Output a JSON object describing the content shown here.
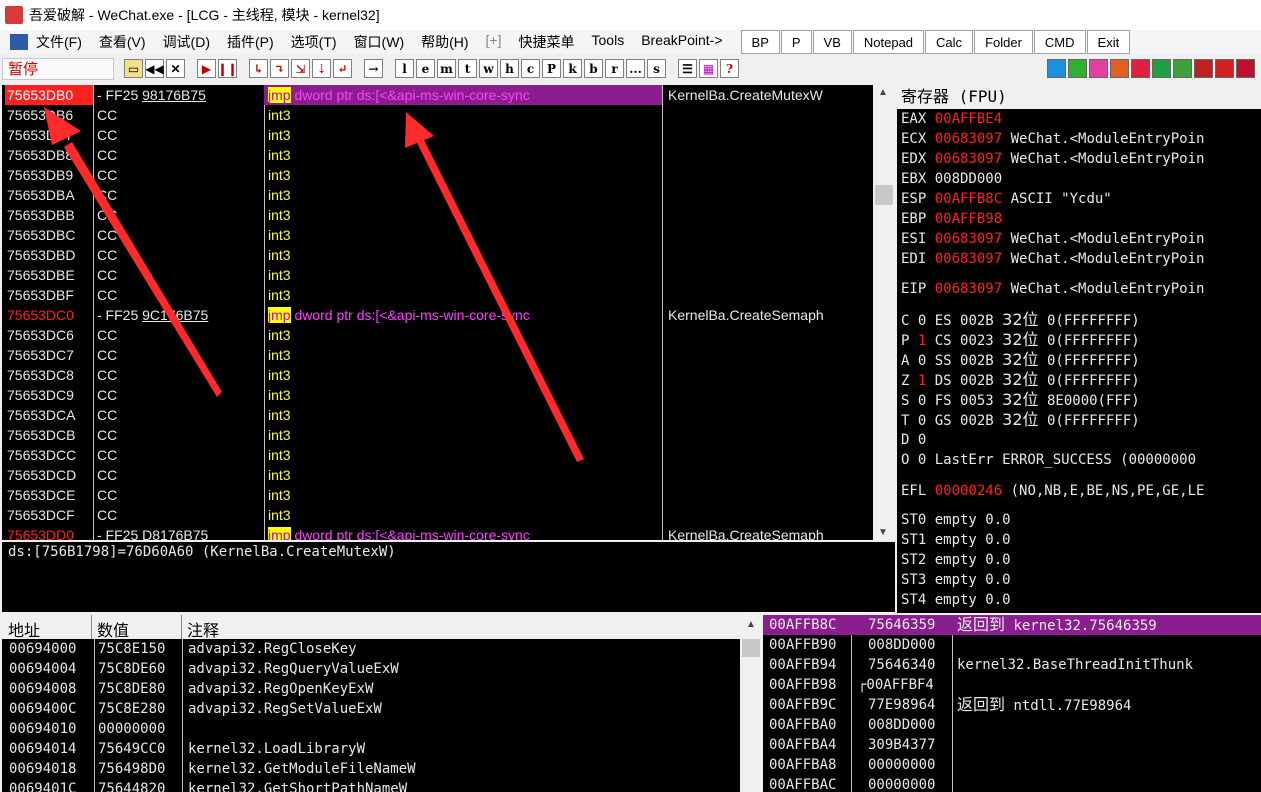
{
  "window": {
    "title": "吾爱破解 - WeChat.exe - [LCG -  主线程, 模块 - kernel32]"
  },
  "menu": {
    "items": [
      "文件(F)",
      "查看(V)",
      "调试(D)",
      "插件(P)",
      "选项(T)",
      "窗口(W)",
      "帮助(H)",
      "[+]",
      "快捷菜单",
      "Tools",
      "BreakPoint->"
    ],
    "buttons": [
      "BP",
      "P",
      "VB",
      "Notepad",
      "Calc",
      "Folder",
      "CMD",
      "Exit"
    ]
  },
  "toolbar": {
    "state": "暂停",
    "letters": [
      "l",
      "e",
      "m",
      "t",
      "w",
      "h",
      "c",
      "P",
      "k",
      "b",
      "r",
      "...",
      "s"
    ],
    "colors": {
      "plugin_boxes": [
        "#1e8fe0",
        "#2fb02f",
        "#e040a0",
        "#e06020",
        "#e02040",
        "#20a040",
        "#40a040",
        "#c02020",
        "#d02020",
        "#c01030"
      ]
    }
  },
  "disasm": {
    "rows": [
      {
        "addr": "75653DB0",
        "sep": "-",
        "hex": "FF25",
        "hexu": "98176B75",
        "asm_kw": "jmp",
        "asm": " dword ptr ds:[<&api-ms-win-core-sync",
        "cmt": "KernelBa.CreateMutexW",
        "highlight": true
      },
      {
        "addr": "75653DB6",
        "hex": "CC",
        "asm": "int3"
      },
      {
        "addr": "75653DB7",
        "hex": "CC",
        "asm": "int3"
      },
      {
        "addr": "75653DB8",
        "hex": "CC",
        "asm": "int3"
      },
      {
        "addr": "75653DB9",
        "hex": "CC",
        "asm": "int3"
      },
      {
        "addr": "75653DBA",
        "hex": "CC",
        "asm": "int3"
      },
      {
        "addr": "75653DBB",
        "hex": "CC",
        "asm": "int3"
      },
      {
        "addr": "75653DBC",
        "hex": "CC",
        "asm": "int3"
      },
      {
        "addr": "75653DBD",
        "hex": "CC",
        "asm": "int3"
      },
      {
        "addr": "75653DBE",
        "hex": "CC",
        "asm": "int3"
      },
      {
        "addr": "75653DBF",
        "hex": "CC",
        "asm": "int3"
      },
      {
        "addr": "75653DC0",
        "sep": "-",
        "hex": "FF25",
        "hexu": "9C176B75",
        "asm_kw": "jmp",
        "asm": " dword ptr ds:[<&api-ms-win-core-sync",
        "cmt": "KernelBa.CreateSemaph",
        "red": true
      },
      {
        "addr": "75653DC6",
        "hex": "CC",
        "asm": "int3"
      },
      {
        "addr": "75653DC7",
        "hex": "CC",
        "asm": "int3"
      },
      {
        "addr": "75653DC8",
        "hex": "CC",
        "asm": "int3"
      },
      {
        "addr": "75653DC9",
        "hex": "CC",
        "asm": "int3"
      },
      {
        "addr": "75653DCA",
        "hex": "CC",
        "asm": "int3"
      },
      {
        "addr": "75653DCB",
        "hex": "CC",
        "asm": "int3"
      },
      {
        "addr": "75653DCC",
        "hex": "CC",
        "asm": "int3"
      },
      {
        "addr": "75653DCD",
        "hex": "CC",
        "asm": "int3"
      },
      {
        "addr": "75653DCE",
        "hex": "CC",
        "asm": "int3"
      },
      {
        "addr": "75653DCF",
        "hex": "CC",
        "asm": "int3"
      },
      {
        "addr": "75653DD0",
        "sep": "-",
        "hex": "FF25",
        "hexu": "D8176B75",
        "asm_kw": "jmp",
        "asm": " dword ptr ds:[<&api-ms-win-core-sync",
        "cmt": "KernelBa.CreateSemaph",
        "red": true
      }
    ]
  },
  "info": {
    "line": "ds:[756B1798]=76D60A60 (KernelBa.CreateMutexW)"
  },
  "registers": {
    "title": "寄存器 (FPU)",
    "gp": [
      {
        "name": "EAX",
        "value": "00AFFBE4",
        "note": "",
        "changed": true
      },
      {
        "name": "ECX",
        "value": "00683097",
        "note": "WeChat.<ModuleEntryPoin",
        "changed": true
      },
      {
        "name": "EDX",
        "value": "00683097",
        "note": "WeChat.<ModuleEntryPoin",
        "changed": true
      },
      {
        "name": "EBX",
        "value": "008DD000",
        "note": "",
        "changed": false
      },
      {
        "name": "ESP",
        "value": "00AFFB8C",
        "note": "ASCII \"Ycdu\"",
        "changed": true
      },
      {
        "name": "EBP",
        "value": "00AFFB98",
        "note": "",
        "changed": true
      },
      {
        "name": "ESI",
        "value": "00683097",
        "note": "WeChat.<ModuleEntryPoin",
        "changed": true
      },
      {
        "name": "EDI",
        "value": "00683097",
        "note": "WeChat.<ModuleEntryPoin",
        "changed": true
      }
    ],
    "eip": {
      "name": "EIP",
      "value": "00683097",
      "note": "WeChat.<ModuleEntryPoin"
    },
    "segs": [
      {
        "flag": "C",
        "fv": "0",
        "seg": "ES",
        "sv": "002B",
        "bits": "32位",
        "base": "0(FFFFFFFF)",
        "fred": false
      },
      {
        "flag": "P",
        "fv": "1",
        "seg": "CS",
        "sv": "0023",
        "bits": "32位",
        "base": "0(FFFFFFFF)",
        "fred": true
      },
      {
        "flag": "A",
        "fv": "0",
        "seg": "SS",
        "sv": "002B",
        "bits": "32位",
        "base": "0(FFFFFFFF)",
        "fred": false
      },
      {
        "flag": "Z",
        "fv": "1",
        "seg": "DS",
        "sv": "002B",
        "bits": "32位",
        "base": "0(FFFFFFFF)",
        "fred": true
      },
      {
        "flag": "S",
        "fv": "0",
        "seg": "FS",
        "sv": "0053",
        "bits": "32位",
        "base": "8E0000(FFF)",
        "fred": false
      },
      {
        "flag": "T",
        "fv": "0",
        "seg": "GS",
        "sv": "002B",
        "bits": "32位",
        "base": "0(FFFFFFFF)",
        "fred": false
      }
    ],
    "d_flag": "D 0",
    "o_line": {
      "flag": "O 0",
      "text": "LastErr ERROR_SUCCESS (00000000"
    },
    "efl": {
      "name": "EFL",
      "value": "00000246",
      "note": "(NO,NB,E,BE,NS,PE,GE,LE"
    },
    "fpu": [
      "ST0 empty 0.0",
      "ST1 empty 0.0",
      "ST2 empty 0.0",
      "ST3 empty 0.0",
      "ST4 empty 0.0"
    ]
  },
  "dump": {
    "headers": [
      "地址",
      "数值",
      "注释"
    ],
    "rows": [
      {
        "addr": "00694000",
        "val": "75C8E150",
        "cmt": "advapi32.RegCloseKey"
      },
      {
        "addr": "00694004",
        "val": "75C8DE60",
        "cmt": "advapi32.RegQueryValueExW"
      },
      {
        "addr": "00694008",
        "val": "75C8DE80",
        "cmt": "advapi32.RegOpenKeyExW"
      },
      {
        "addr": "0069400C",
        "val": "75C8E280",
        "cmt": "advapi32.RegSetValueExW"
      },
      {
        "addr": "00694010",
        "val": "00000000",
        "cmt": ""
      },
      {
        "addr": "00694014",
        "val": "75649CC0",
        "cmt": "kernel32.LoadLibraryW"
      },
      {
        "addr": "00694018",
        "val": "756498D0",
        "cmt": "kernel32.GetModuleFileNameW"
      },
      {
        "addr": "0069401C",
        "val": "75644820",
        "cmt": "kernel32.GetShortPathNameW"
      }
    ]
  },
  "stack": {
    "rows": [
      {
        "addr": "00AFFB8C",
        "val": "75646359",
        "cmt": "返回到 kernel32.75646359",
        "sel": true
      },
      {
        "addr": "00AFFB90",
        "val": "008DD000",
        "cmt": ""
      },
      {
        "addr": "00AFFB94",
        "val": "75646340",
        "cmt": "kernel32.BaseThreadInitThunk"
      },
      {
        "addr": "00AFFB98",
        "val": "┌00AFFBF4",
        "cmt": ""
      },
      {
        "addr": "00AFFB9C",
        "val": "77E98964",
        "cmt": "返回到 ntdll.77E98964"
      },
      {
        "addr": "00AFFBA0",
        "val": "008DD000",
        "cmt": ""
      },
      {
        "addr": "00AFFBA4",
        "val": "309B4377",
        "cmt": ""
      },
      {
        "addr": "00AFFBA8",
        "val": "00000000",
        "cmt": ""
      },
      {
        "addr": "00AFFBAC",
        "val": "00000000",
        "cmt": ""
      }
    ]
  }
}
